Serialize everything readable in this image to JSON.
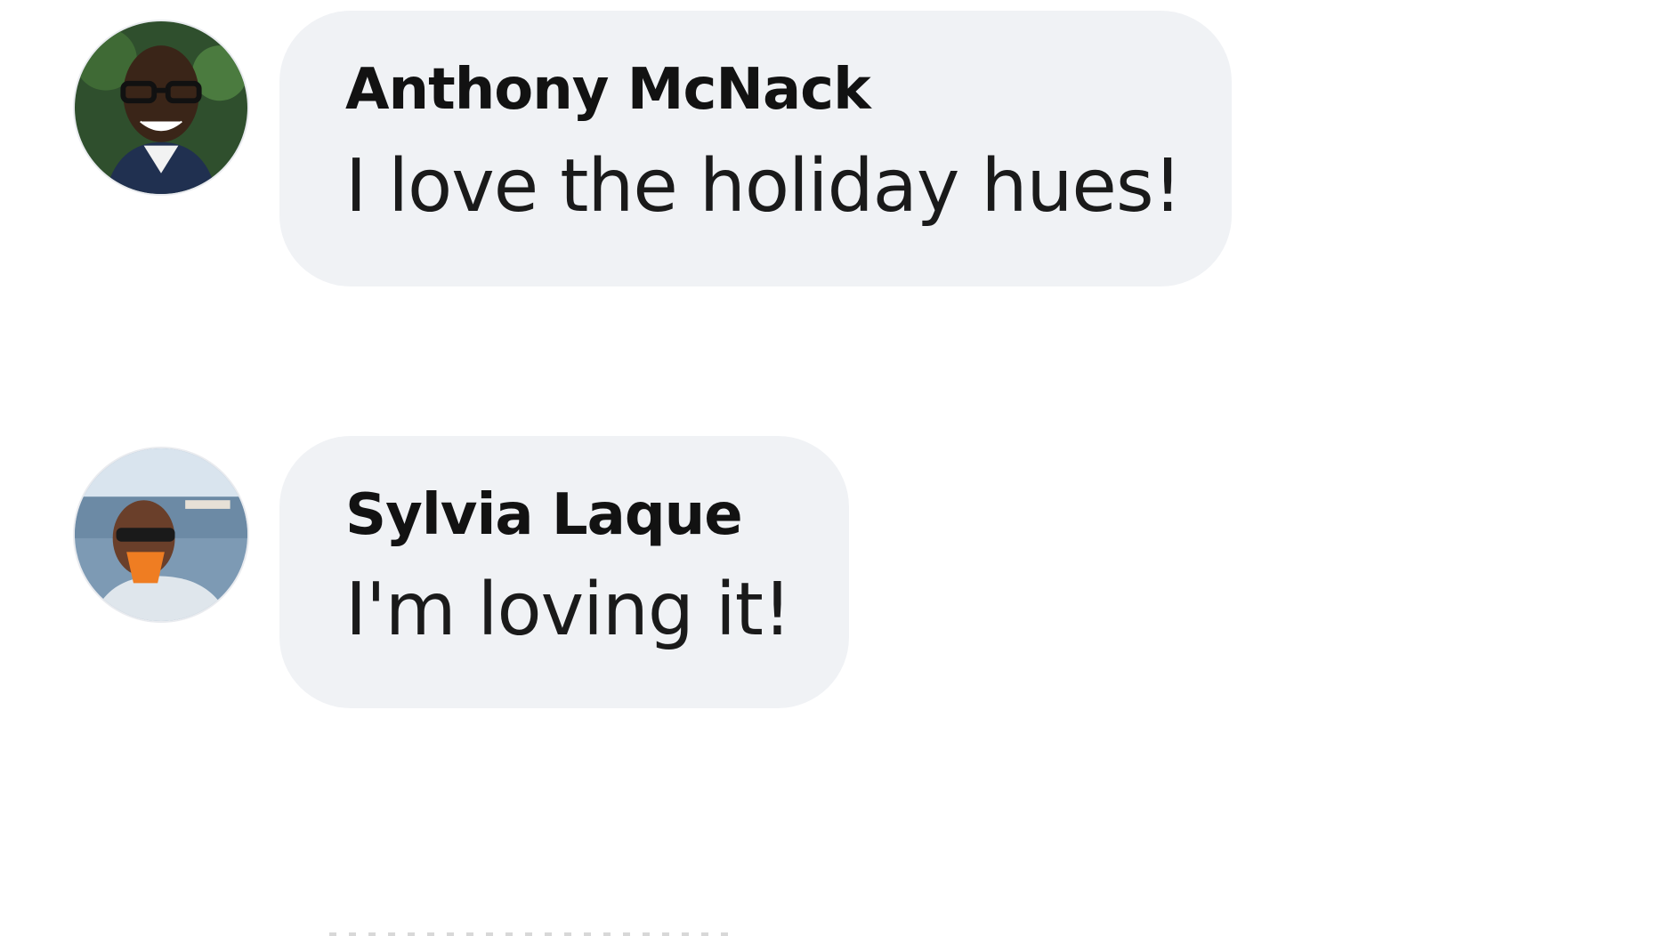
{
  "comments": [
    {
      "author": "Anthony McNack",
      "message": "I love the holiday hues!",
      "avatar_icon": "person-avatar-icon"
    },
    {
      "author": "Sylvia Laque",
      "message": "I'm loving it!",
      "avatar_icon": "person-avatar-icon"
    }
  ],
  "colors": {
    "bubble_background": "#f0f2f5",
    "text": "#1a1a1a",
    "page_background": "#ffffff"
  }
}
